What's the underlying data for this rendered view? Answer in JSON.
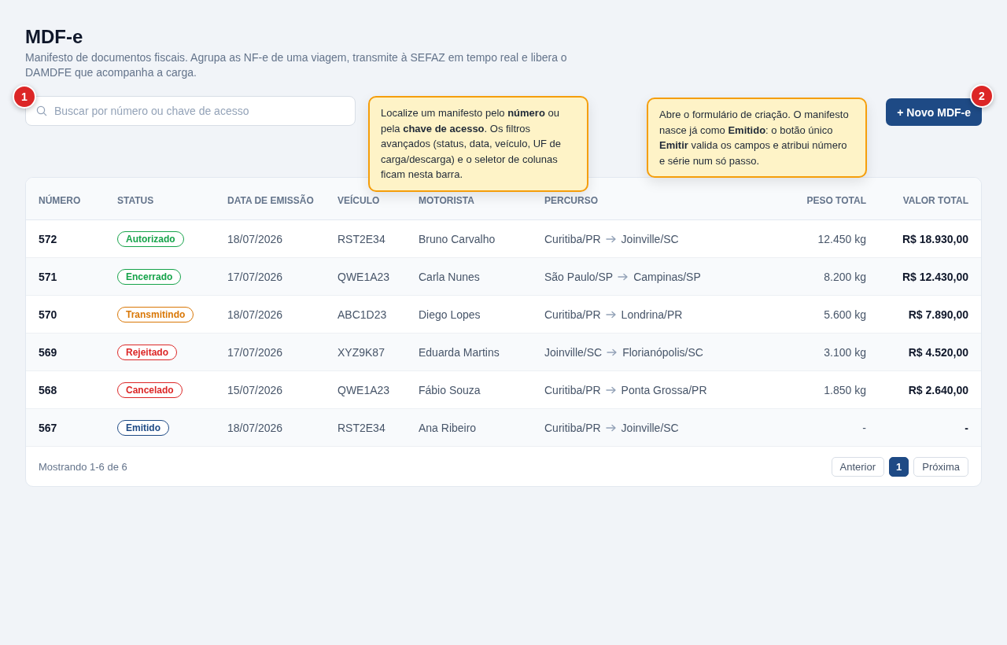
{
  "page": {
    "title": "MDF-e",
    "description": "Manifesto de documentos fiscais. Agrupa as NF-e de uma viagem, transmite à SEFAZ em tempo real e libera o DAMDFE que acompanha a carga."
  },
  "search": {
    "placeholder": "Buscar por número ou chave de acesso",
    "step": "1",
    "tooltip": "Localize um manifesto pelo **número** ou pela **chave de acesso**. Os filtros avançados (status, data, veículo, UF de carga/descarga) e o seletor de colunas ficam nesta barra."
  },
  "new_button": {
    "label": "+ Novo MDF-e",
    "step": "2",
    "tooltip": "Abre o formulário de criação. O manifesto nasce já como **Emitido**: o botão único **Emitir** valida os campos e atribui número e série num só passo."
  },
  "table": {
    "columns": [
      "NÚMERO",
      "STATUS",
      "DATA DE EMISSÃO",
      "VEÍCULO",
      "MOTORISTA",
      "PERCURSO",
      "PESO TOTAL",
      "VALOR TOTAL"
    ],
    "rows": [
      {
        "numero": "572",
        "status": {
          "label": "Autorizado",
          "color": "#16a34a"
        },
        "data": "18/07/2026",
        "veiculo": "RST2E34",
        "motorista": "Bruno Carvalho",
        "origem": "Curitiba/PR",
        "destino": "Joinville/SC",
        "peso": "12.450 kg",
        "valor": "R$ 18.930,00"
      },
      {
        "numero": "571",
        "status": {
          "label": "Encerrado",
          "color": "#16a34a"
        },
        "data": "17/07/2026",
        "veiculo": "QWE1A23",
        "motorista": "Carla Nunes",
        "origem": "São Paulo/SP",
        "destino": "Campinas/SP",
        "peso": "8.200 kg",
        "valor": "R$ 12.430,00"
      },
      {
        "numero": "570",
        "status": {
          "label": "Transmitindo",
          "color": "#d97706"
        },
        "data": "18/07/2026",
        "veiculo": "ABC1D23",
        "motorista": "Diego Lopes",
        "origem": "Curitiba/PR",
        "destino": "Londrina/PR",
        "peso": "5.600 kg",
        "valor": "R$ 7.890,00"
      },
      {
        "numero": "569",
        "status": {
          "label": "Rejeitado",
          "color": "#dc2626"
        },
        "data": "17/07/2026",
        "veiculo": "XYZ9K87",
        "motorista": "Eduarda Martins",
        "origem": "Joinville/SC",
        "destino": "Florianópolis/SC",
        "peso": "3.100 kg",
        "valor": "R$ 4.520,00"
      },
      {
        "numero": "568",
        "status": {
          "label": "Cancelado",
          "color": "#dc2626"
        },
        "data": "15/07/2026",
        "veiculo": "QWE1A23",
        "motorista": "Fábio Souza",
        "origem": "Curitiba/PR",
        "destino": "Ponta Grossa/PR",
        "peso": "1.850 kg",
        "valor": "R$ 2.640,00"
      },
      {
        "numero": "567",
        "status": {
          "label": "Emitido",
          "color": "#1e4a85"
        },
        "data": "18/07/2026",
        "veiculo": "RST2E34",
        "motorista": "Ana Ribeiro",
        "origem": "Curitiba/PR",
        "destino": "Joinville/SC",
        "peso": "-",
        "valor": "-"
      }
    ]
  },
  "footer": {
    "summary": "Mostrando 1-6 de 6",
    "pagination": [
      {
        "label": "Anterior",
        "kind": "nav",
        "selected": false
      },
      {
        "label": "1",
        "kind": "page",
        "selected": true
      },
      {
        "label": "Próxima",
        "kind": "nav",
        "selected": false
      }
    ]
  }
}
